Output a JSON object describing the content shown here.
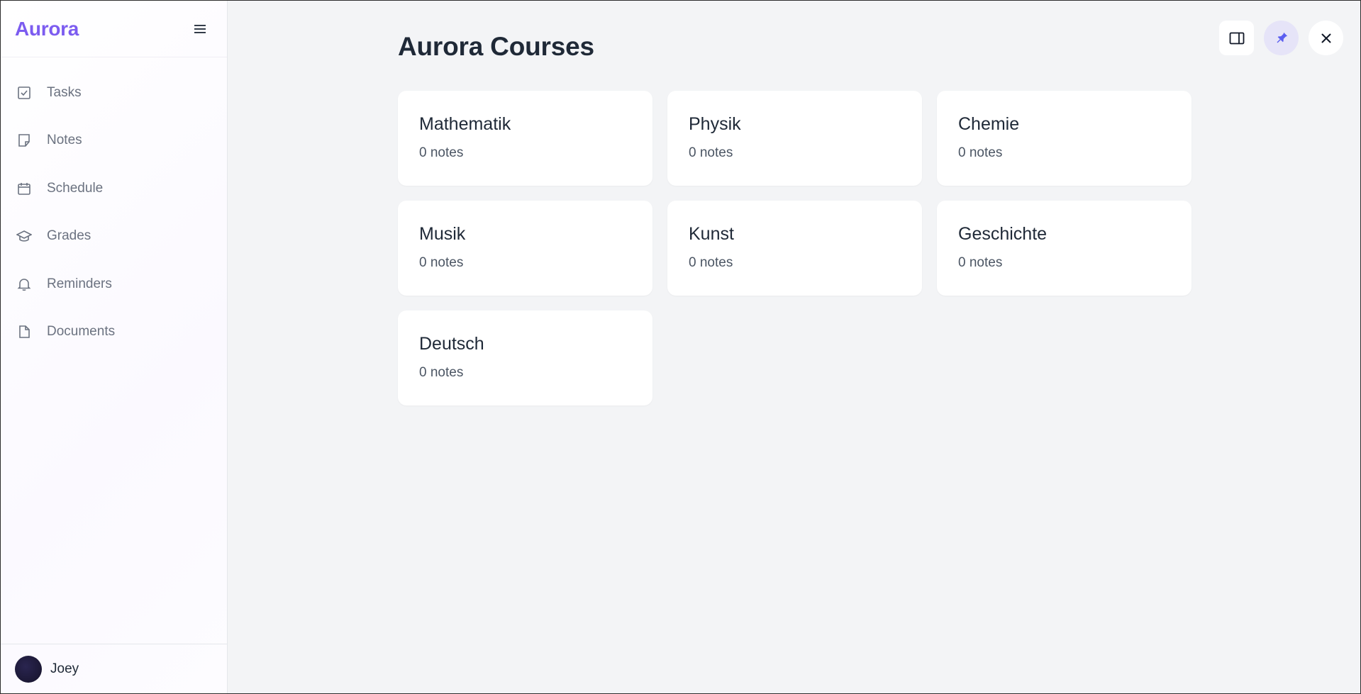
{
  "app": {
    "name": "Aurora"
  },
  "sidebar": {
    "items": [
      {
        "label": "Tasks",
        "icon": "check-square-icon"
      },
      {
        "label": "Notes",
        "icon": "note-icon"
      },
      {
        "label": "Schedule",
        "icon": "calendar-icon"
      },
      {
        "label": "Grades",
        "icon": "graduation-cap-icon"
      },
      {
        "label": "Reminders",
        "icon": "bell-icon"
      },
      {
        "label": "Documents",
        "icon": "file-icon"
      }
    ],
    "user": {
      "name": "Joey"
    }
  },
  "main": {
    "title": "Aurora Courses",
    "courses": [
      {
        "name": "Mathematik",
        "notes": "0 notes"
      },
      {
        "name": "Physik",
        "notes": "0 notes"
      },
      {
        "name": "Chemie",
        "notes": "0 notes"
      },
      {
        "name": "Musik",
        "notes": "0 notes"
      },
      {
        "name": "Kunst",
        "notes": "0 notes"
      },
      {
        "name": "Geschichte",
        "notes": "0 notes"
      },
      {
        "name": "Deutsch",
        "notes": "0 notes"
      }
    ]
  },
  "colors": {
    "brand": "#7c5cf0",
    "pin_accent": "#5b5ef0",
    "background": "#f3f4f6"
  }
}
